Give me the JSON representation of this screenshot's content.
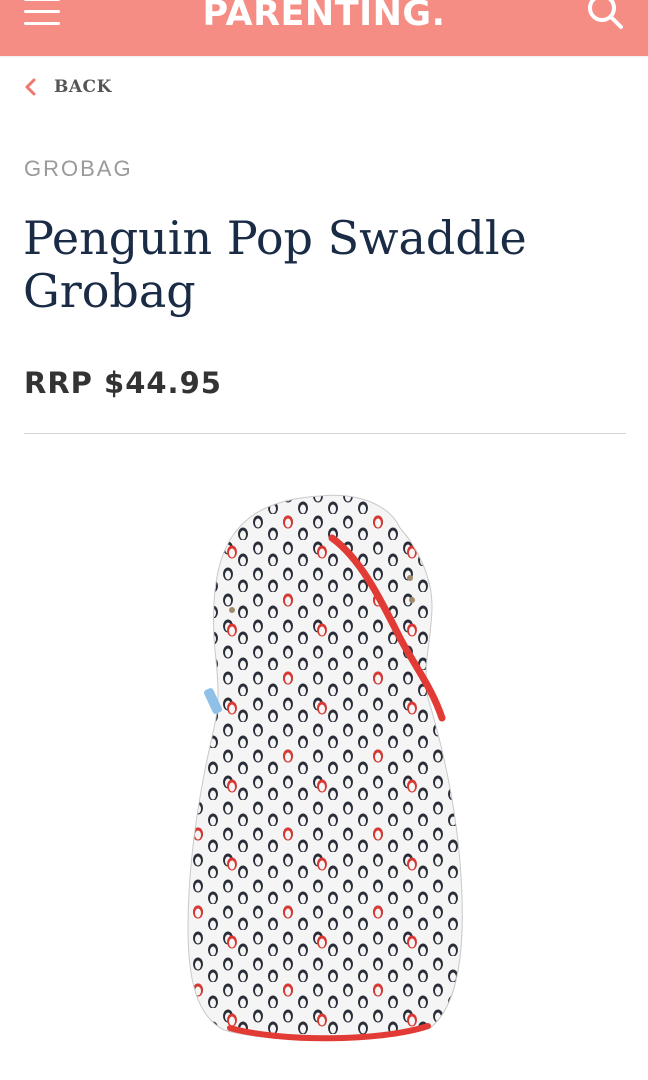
{
  "header": {
    "logo": "PARENTING.",
    "menu_icon": "hamburger-menu-icon",
    "search_icon": "search-icon",
    "bar_color": "#f58d84"
  },
  "nav": {
    "back_label": "BACK",
    "back_icon": "chevron-left-icon"
  },
  "product": {
    "brand": "GROBAG",
    "title": "Penguin Pop Swaddle Grobag",
    "price": "RRP $44.95",
    "image_icon": "grobag-product-image",
    "title_color": "#1a2b45",
    "accent_color": "#e23b35"
  }
}
